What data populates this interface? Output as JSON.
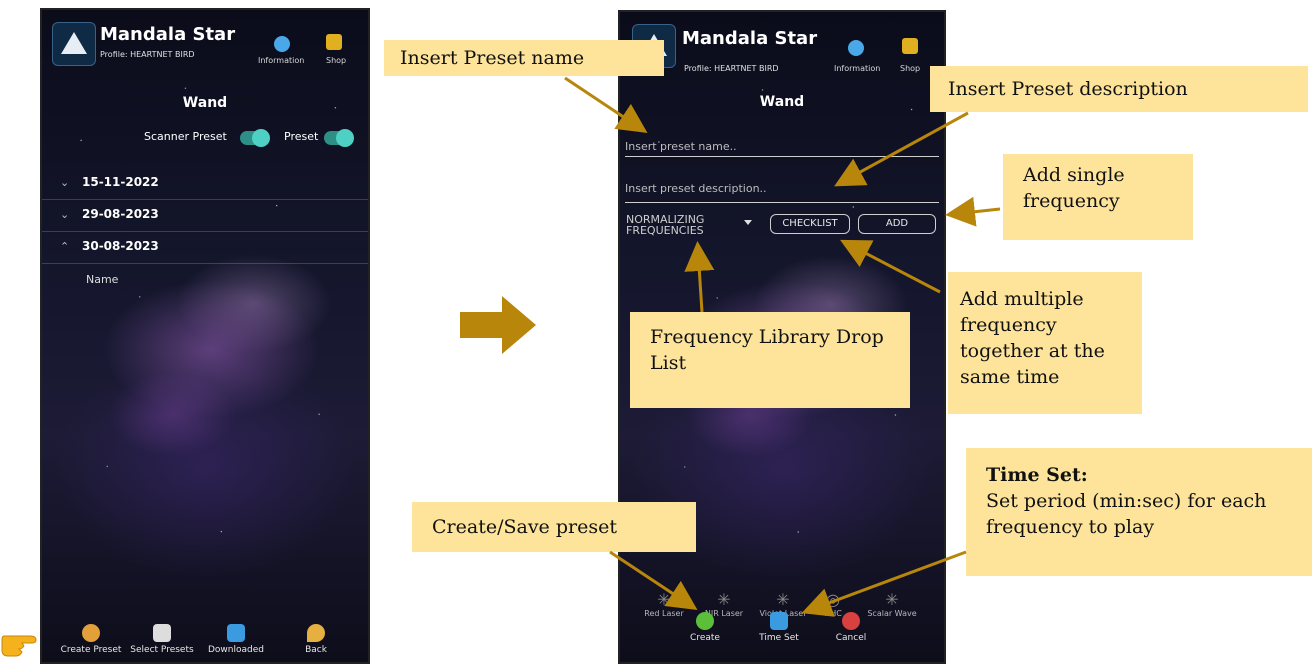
{
  "left_phone": {
    "app_title": "Mandala Star",
    "profile": "Profile: HEARTNET BIRD",
    "header_icons": [
      {
        "label": "Information",
        "icon": "globe-icon",
        "color": "#4aa8e8"
      },
      {
        "label": "Shop",
        "icon": "shopping-cart-icon",
        "color": "#e0b020"
      }
    ],
    "screen_title": "Wand",
    "toggles": [
      {
        "label": "Scanner Preset",
        "state": true
      },
      {
        "label": "Preset",
        "state": true
      }
    ],
    "dates": [
      {
        "chevron": "⌄",
        "date": "15-11-2022"
      },
      {
        "chevron": "⌄",
        "date": "29-08-2023"
      },
      {
        "chevron": "⌃",
        "date": "30-08-2023"
      }
    ],
    "name_column": "Name",
    "bottom_bar": [
      {
        "label": "Create Preset",
        "icon": "create-preset-icon",
        "color": "#e2a03a"
      },
      {
        "label": "Select Presets",
        "icon": "checklist-icon",
        "color": "#dddddd"
      },
      {
        "label": "Downloaded",
        "icon": "download-icon",
        "color": "#3a9be0"
      },
      {
        "label": "Back",
        "icon": "back-arrow-icon",
        "color": "#e6b040"
      }
    ]
  },
  "right_phone": {
    "app_title": "Mandala Star",
    "profile": "Profile: HEARTNET BIRD",
    "header_icons": [
      {
        "label": "Information",
        "icon": "globe-icon"
      },
      {
        "label": "Shop",
        "icon": "shopping-cart-icon"
      }
    ],
    "screen_title": "Wand",
    "name_placeholder": "Insert preset name..",
    "description_placeholder": "Insert preset description..",
    "dropdown_text": "NORMALIZING FREQUENCIES",
    "checklist_button": "CHECKLIST",
    "add_button": "ADD",
    "lasers": [
      "Red Laser",
      "NIR Laser",
      "Violet Laser",
      "HHC",
      "Scalar Wave"
    ],
    "actions": [
      {
        "label": "Create",
        "icon": "check-circle-icon",
        "color": "#5cbf3a"
      },
      {
        "label": "Time Set",
        "icon": "refresh-icon",
        "color": "#3a9be0"
      },
      {
        "label": "Cancel",
        "icon": "close-circle-icon",
        "color": "#d94040"
      }
    ]
  },
  "callouts": {
    "preset_name": "Insert Preset name",
    "preset_description": "Insert Preset description",
    "single_frequency": "Add single frequency",
    "multiple_frequency": "Add multiple frequency together at the same time",
    "library": "Frequency Library Drop List",
    "time_set_title": "Time Set:",
    "time_set_body": "Set period (min:sec) for each frequency to play",
    "create_save": "Create/Save preset"
  },
  "colors": {
    "callout_bg": "#fde49a",
    "arrow": "#b8860b",
    "hand": "#f5b21c"
  }
}
